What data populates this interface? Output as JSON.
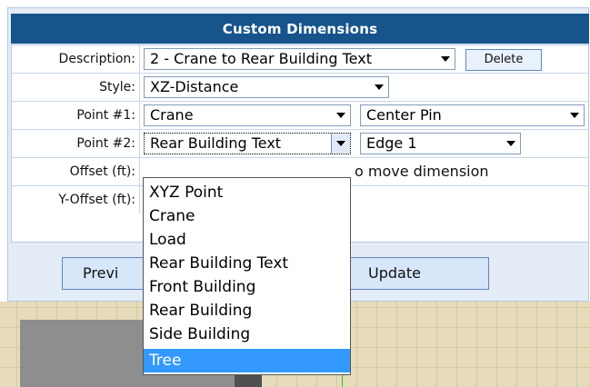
{
  "panel": {
    "title": "Custom Dimensions"
  },
  "form": {
    "description": {
      "label": "Description:",
      "value": "2 - Crane to Rear Building Text",
      "delete_label": "Delete"
    },
    "style": {
      "label": "Style:",
      "value": "XZ-Distance"
    },
    "point1": {
      "label": "Point #1:",
      "object_value": "Crane",
      "point_value": "Center Pin"
    },
    "point2": {
      "label": "Point #2:",
      "object_value": "Rear Building Text",
      "point_value": "Edge 1"
    },
    "offset": {
      "label": "Offset (ft):",
      "hint_partial": "o move dimension"
    },
    "y_offset": {
      "label": "Y-Offset (ft):"
    }
  },
  "buttons": {
    "preview_partial": "Previ",
    "update": "Update"
  },
  "dropdown": {
    "options": [
      "XYZ Point",
      "Crane",
      "Load",
      "Rear Building Text",
      "Front Building",
      "Rear Building",
      "Side Building",
      "Tree"
    ],
    "highlighted": "Tree"
  },
  "colors": {
    "header_bg": "#17548c",
    "panel_bg": "#e4ecf7",
    "highlight": "#3399ff",
    "canvas_bg": "#e6dcbc"
  }
}
